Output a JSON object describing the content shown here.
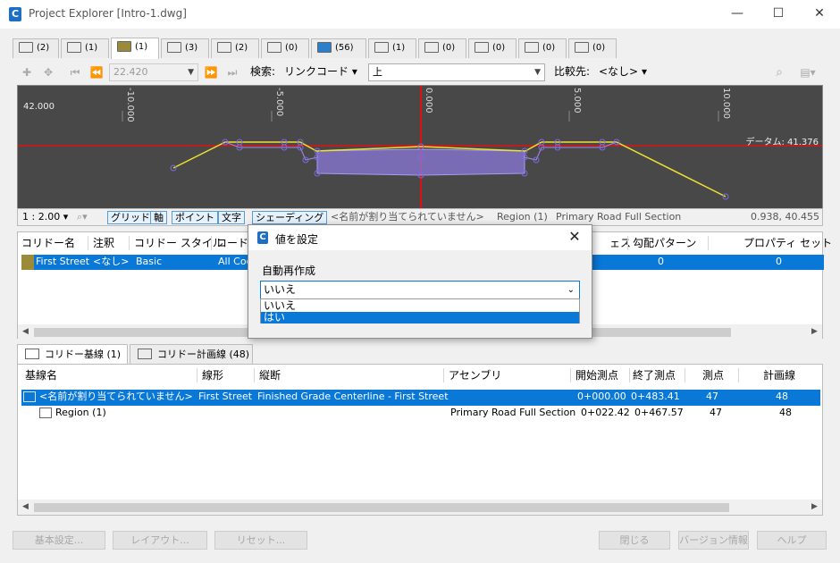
{
  "window": {
    "title": "Project Explorer [Intro-1.dwg]",
    "logo_letter": "C",
    "minimize": "—",
    "maximize": "☐",
    "close": "✕"
  },
  "tabs": [
    {
      "count": "(2)",
      "active": false
    },
    {
      "count": "(1)",
      "active": false
    },
    {
      "count": "(1)",
      "active": true
    },
    {
      "count": "(3)",
      "active": false
    },
    {
      "count": "(2)",
      "active": false
    },
    {
      "count": "(0)",
      "active": false
    },
    {
      "count": "(56)",
      "active": false
    },
    {
      "count": "(1)",
      "active": false
    },
    {
      "count": "(0)",
      "active": false
    },
    {
      "count": "(0)",
      "active": false
    },
    {
      "count": "(0)",
      "active": false
    },
    {
      "count": "(0)",
      "active": false
    }
  ],
  "toolbar": {
    "station_value": "22.420",
    "search_label": "検索:",
    "link_code_label": "リンクコード",
    "link_value": "上",
    "compare_label": "比較先:",
    "compare_value": "<なし>"
  },
  "viewer": {
    "elevation_label": "42.000",
    "datum_label": "データム: 41.376",
    "offset_labels": [
      "-10.000",
      "-5.000",
      "0.000",
      "5.000",
      "10.000"
    ],
    "scale": "1 : 2.00",
    "grid_btn": "グリッド",
    "axis_btn": "軸",
    "point_btn": "ポイント",
    "text_btn": "文字",
    "shading_btn": "シェーディング",
    "unnamed": "<名前が割り当てられていません>",
    "region": "Region (1)",
    "assembly": "Primary Road Full Section",
    "coords": "0.938, 40.455"
  },
  "corridor_grid": {
    "headers": [
      "コリドー名",
      "注釈",
      "コリドー スタイル",
      "コード セ",
      "ェス",
      "勾配パターン",
      "プロパティ セット"
    ],
    "row": {
      "name": "First Street",
      "note": "<なし>",
      "style": "Basic",
      "code": "All Coc",
      "slope": "0",
      "prop": "0"
    }
  },
  "subtabs": [
    {
      "label": "コリドー基線 (1)",
      "active": true
    },
    {
      "label": "コリドー計画線 (48)",
      "active": false
    }
  ],
  "baseline_grid": {
    "headers": [
      "基線名",
      "線形",
      "縦断",
      "アセンブリ",
      "開始測点",
      "終了測点",
      "測点",
      "計画線"
    ],
    "rows": [
      {
        "name": "<名前が割り当てられていません>",
        "align": "First Street",
        "profile": "Finished Grade Centerline - First Street",
        "assembly": "",
        "start": "0+000.00",
        "end": "0+483.41",
        "stations": "47",
        "lines": "48",
        "selected": true
      },
      {
        "name": "Region (1)",
        "align": "",
        "profile": "",
        "assembly": "Primary Road Full Section",
        "start": "0+022.42",
        "end": "0+467.57",
        "stations": "47",
        "lines": "48",
        "selected": false
      }
    ]
  },
  "bottom_buttons": {
    "settings": "基本設定...",
    "layout": "レイアウト...",
    "reset": "リセット...",
    "close": "閉じる",
    "version": "バージョン情報",
    "help": "ヘルプ"
  },
  "dialog": {
    "title": "値を設定",
    "field_label": "自動再作成",
    "value": "いいえ",
    "options": [
      "いいえ",
      "はい"
    ],
    "highlighted_option": "はい"
  },
  "colors": {
    "accent": "#0a78d7",
    "canvas_bg": "#484848",
    "centerline": "#e01010",
    "surface_line": "#f0e030",
    "assembly_fill": "#8a78d8"
  }
}
